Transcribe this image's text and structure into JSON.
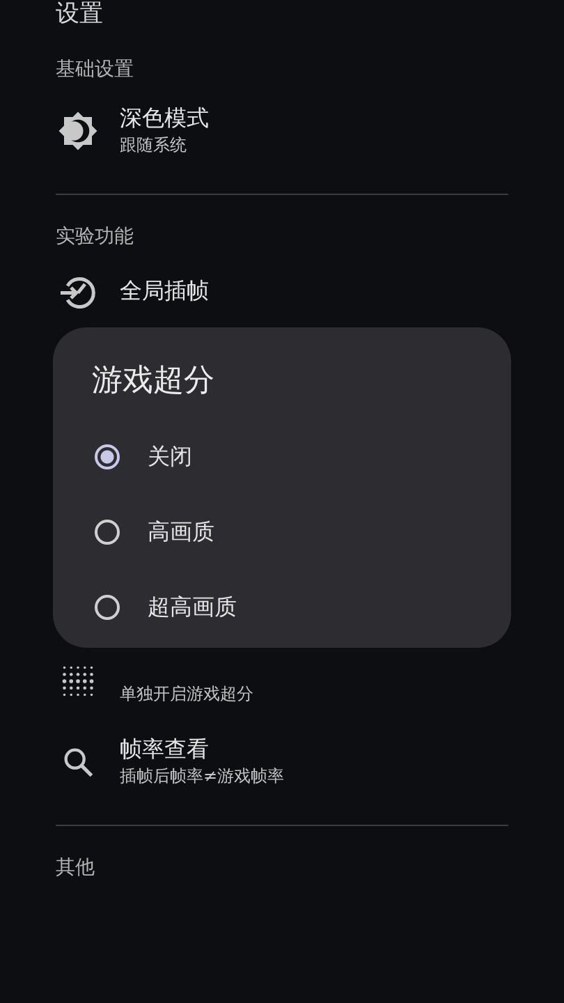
{
  "page_title": "设置",
  "sections": [
    {
      "header": "基础设置",
      "items": [
        {
          "title": "深色模式",
          "subtitle": "跟随系统"
        }
      ]
    },
    {
      "header": "实验功能",
      "items": [
        {
          "title": "全局插帧"
        },
        {
          "subtitle": "单独开启游戏超分"
        },
        {
          "title": "帧率查看",
          "subtitle": "插帧后帧率≠游戏帧率"
        }
      ]
    },
    {
      "header": "其他"
    }
  ],
  "dialog": {
    "title": "游戏超分",
    "options": [
      {
        "label": "关闭",
        "selected": true
      },
      {
        "label": "高画质",
        "selected": false
      },
      {
        "label": "超高画质",
        "selected": false
      }
    ]
  }
}
